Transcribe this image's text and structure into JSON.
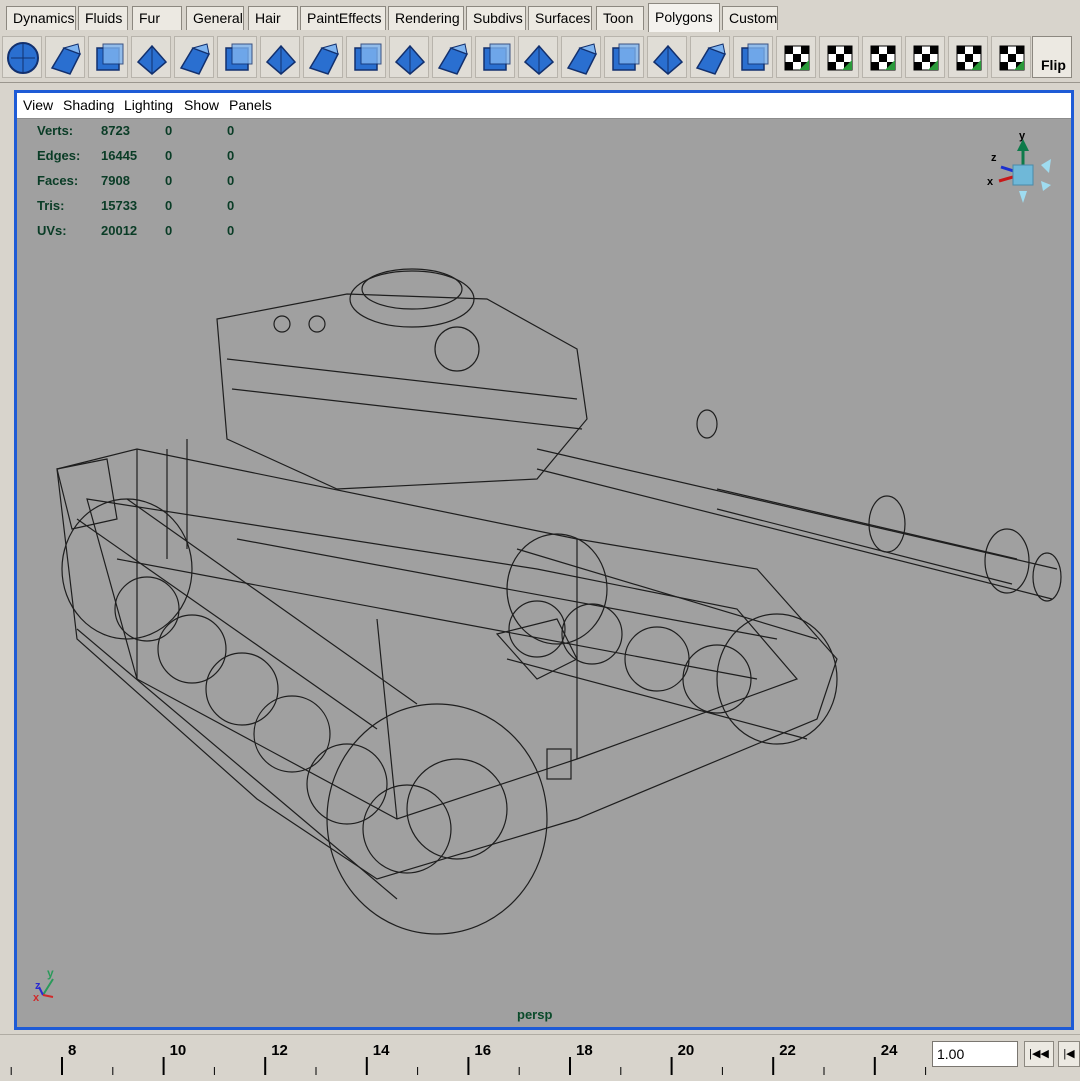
{
  "shelf": {
    "tabs": [
      {
        "label": "Dynamics",
        "active": false
      },
      {
        "label": "Fluids",
        "active": false
      },
      {
        "label": "Fur",
        "active": false
      },
      {
        "label": "General",
        "active": false
      },
      {
        "label": "Hair",
        "active": false
      },
      {
        "label": "PaintEffects",
        "active": false
      },
      {
        "label": "Rendering",
        "active": false
      },
      {
        "label": "Subdivs",
        "active": false
      },
      {
        "label": "Surfaces",
        "active": false
      },
      {
        "label": "Toon",
        "active": false
      },
      {
        "label": "Polygons",
        "active": true
      },
      {
        "label": "Custom",
        "active": false
      }
    ],
    "icons": [
      "polygon-sphere-icon",
      "polygon-cube-icon",
      "polygon-cylinder-icon",
      "polygon-cone-icon",
      "polygon-torus-icon",
      "polygon-plane-icon",
      "split-polygon-icon",
      "extrude-face-icon",
      "extrude-edge-icon",
      "bevel-icon",
      "merge-vertices-icon",
      "append-polygon-icon",
      "cut-faces-icon",
      "subdivide-icon",
      "smooth-icon",
      "combine-icon",
      "separate-icon",
      "move-pivot-icon",
      "planar-map-icon",
      "cylindrical-map-icon",
      "spherical-map-icon",
      "automatic-map-icon",
      "uv-editor-icon",
      "uv-snapshot-icon"
    ],
    "flip_label": "Flip"
  },
  "panel": {
    "menu": [
      "View",
      "Shading",
      "Lighting",
      "Show",
      "Panels"
    ],
    "camera": "persp",
    "stats": [
      {
        "label": "Verts:",
        "v1": "8723",
        "v2": "0",
        "v3": "0"
      },
      {
        "label": "Edges:",
        "v1": "16445",
        "v2": "0",
        "v3": "0"
      },
      {
        "label": "Faces:",
        "v1": "7908",
        "v2": "0",
        "v3": "0"
      },
      {
        "label": "Tris:",
        "v1": "15733",
        "v2": "0",
        "v3": "0"
      },
      {
        "label": "UVs:",
        "v1": "20012",
        "v2": "0",
        "v3": "0"
      }
    ],
    "view_cube_axes": {
      "y": "y",
      "z": "z",
      "x": "x"
    },
    "axis_indicator": {
      "y": "y",
      "z": "z",
      "x": "x"
    },
    "colors": {
      "border": "#1e5bd6",
      "background": "#a0a0a0",
      "hud_text": "#0a3c26"
    }
  },
  "timeline": {
    "ticks": [
      8,
      10,
      12,
      14,
      16,
      18,
      20,
      22,
      24
    ],
    "current_frame": "1.00",
    "buttons": [
      "go-to-start-icon",
      "step-back-icon"
    ]
  }
}
